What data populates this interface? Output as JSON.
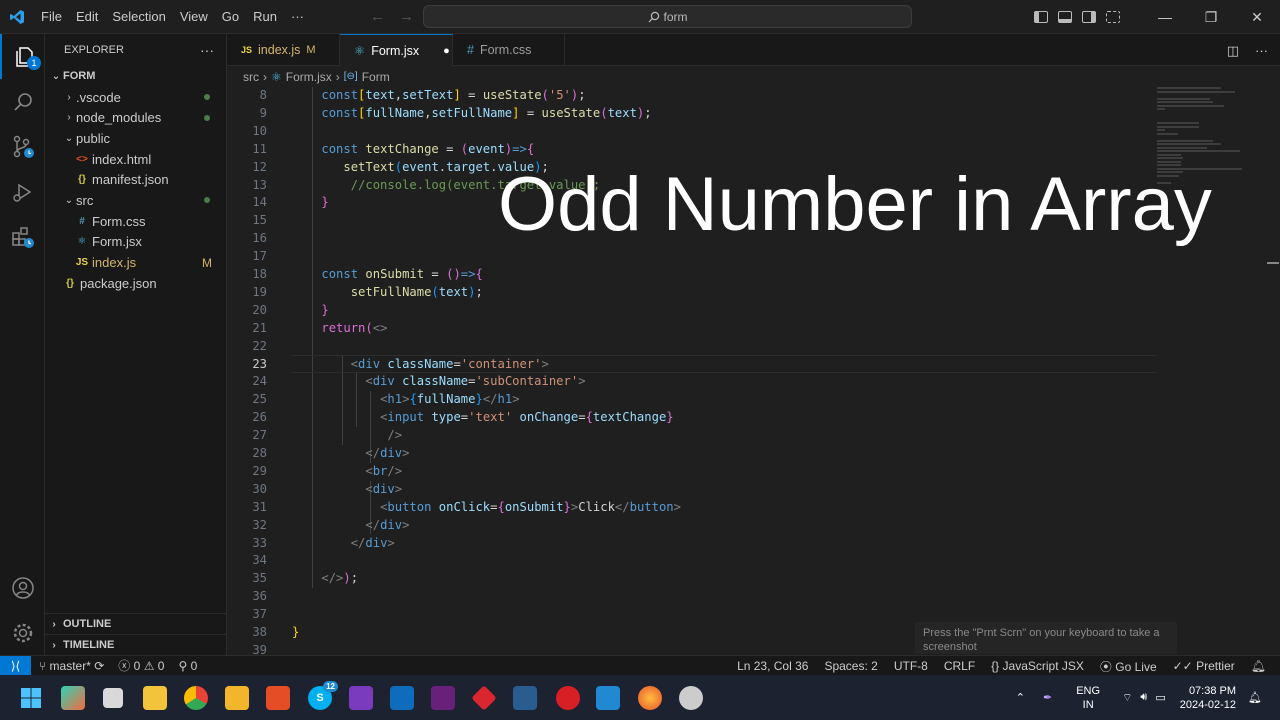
{
  "titlebar": {
    "menu": [
      "File",
      "Edit",
      "Selection",
      "View",
      "Go",
      "Run",
      "···"
    ],
    "search_text": "form",
    "minimize": "—",
    "maximize": "❐",
    "close": "✕"
  },
  "activity": {
    "explorer_badge": "1"
  },
  "sidebar": {
    "header": "EXPLORER",
    "more": "···",
    "root": "FORM",
    "items": [
      {
        "label": ".vscode",
        "type": "folder",
        "chev": "›",
        "git": "dot"
      },
      {
        "label": "node_modules",
        "type": "folder",
        "chev": "›",
        "git": "dot"
      },
      {
        "label": "public",
        "type": "folder",
        "chev": "⌄",
        "git": ""
      },
      {
        "label": "index.html",
        "type": "html",
        "icon": "<>",
        "git": ""
      },
      {
        "label": "manifest.json",
        "type": "json",
        "icon": "{}",
        "git": ""
      },
      {
        "label": "src",
        "type": "folder",
        "chev": "⌄",
        "git": "dot"
      },
      {
        "label": "Form.css",
        "type": "css",
        "icon": "#",
        "git": ""
      },
      {
        "label": "Form.jsx",
        "type": "jsx",
        "icon": "⚛",
        "git": ""
      },
      {
        "label": "index.js",
        "type": "js",
        "icon": "JS",
        "git": "M"
      },
      {
        "label": "package.json",
        "type": "json",
        "icon": "{}",
        "git": ""
      }
    ],
    "outline": "OUTLINE",
    "timeline": "TIMELINE"
  },
  "tabs": [
    {
      "label": "index.js",
      "icon": "JS",
      "suffix": "M",
      "active": false
    },
    {
      "label": "Form.jsx",
      "icon": "⚛",
      "suffix": "●",
      "active": true
    },
    {
      "label": "Form.css",
      "icon": "#",
      "suffix": "",
      "active": false
    }
  ],
  "breadcrumb": [
    "src",
    "›",
    "Form.jsx",
    "›",
    "Form"
  ],
  "editor": {
    "current_line": 23,
    "overlay_title": "Odd Number in Array",
    "toast": "Press the \"Prnt Scrn\" on your keyboard to take a screenshot",
    "lines": [
      {
        "n": 8,
        "tokens": [
          [
            "    ",
            "txt"
          ],
          [
            "const",
            "kw"
          ],
          [
            "[",
            "br1"
          ],
          [
            "text",
            "var"
          ],
          [
            ",",
            "pun"
          ],
          [
            "setText",
            "var"
          ],
          [
            "]",
            "br1"
          ],
          [
            " = ",
            "pun"
          ],
          [
            "useState",
            "fn"
          ],
          [
            "(",
            "br2"
          ],
          [
            "'5'",
            "str"
          ],
          [
            ")",
            "br2"
          ],
          [
            ";",
            "pun"
          ]
        ]
      },
      {
        "n": 9,
        "tokens": [
          [
            "    ",
            "txt"
          ],
          [
            "const",
            "kw"
          ],
          [
            "[",
            "br1"
          ],
          [
            "fullName",
            "var"
          ],
          [
            ",",
            "pun"
          ],
          [
            "setFullName",
            "var"
          ],
          [
            "]",
            "br1"
          ],
          [
            " = ",
            "pun"
          ],
          [
            "useState",
            "fn"
          ],
          [
            "(",
            "br2"
          ],
          [
            "text",
            "var"
          ],
          [
            ")",
            "br2"
          ],
          [
            ";",
            "pun"
          ]
        ]
      },
      {
        "n": 10,
        "tokens": []
      },
      {
        "n": 11,
        "tokens": [
          [
            "    ",
            "txt"
          ],
          [
            "const",
            "kw"
          ],
          [
            " ",
            "txt"
          ],
          [
            "textChange",
            "fn"
          ],
          [
            " = ",
            "pun"
          ],
          [
            "(",
            "br2"
          ],
          [
            "event",
            "var"
          ],
          [
            ")",
            "br2"
          ],
          [
            "=>",
            "kw"
          ],
          [
            "{",
            "br2"
          ]
        ]
      },
      {
        "n": 12,
        "tokens": [
          [
            "       ",
            "txt"
          ],
          [
            "setText",
            "fn"
          ],
          [
            "(",
            "br3"
          ],
          [
            "event",
            "var"
          ],
          [
            ".",
            "pun"
          ],
          [
            "target",
            "var"
          ],
          [
            ".",
            "pun"
          ],
          [
            "value",
            "var"
          ],
          [
            ")",
            "br3"
          ],
          [
            ";",
            "pun"
          ]
        ]
      },
      {
        "n": 13,
        "tokens": [
          [
            "        ",
            "txt"
          ],
          [
            "//console.log(event.target.value);",
            "cmt"
          ]
        ]
      },
      {
        "n": 14,
        "tokens": [
          [
            "    ",
            "txt"
          ],
          [
            "}",
            "br2"
          ]
        ]
      },
      {
        "n": 15,
        "tokens": []
      },
      {
        "n": 16,
        "tokens": []
      },
      {
        "n": 17,
        "tokens": []
      },
      {
        "n": 18,
        "tokens": [
          [
            "    ",
            "txt"
          ],
          [
            "const",
            "kw"
          ],
          [
            " ",
            "txt"
          ],
          [
            "onSubmit",
            "fn"
          ],
          [
            " = ",
            "pun"
          ],
          [
            "()",
            "br2"
          ],
          [
            "=>",
            "kw"
          ],
          [
            "{",
            "br2"
          ]
        ]
      },
      {
        "n": 19,
        "tokens": [
          [
            "        ",
            "txt"
          ],
          [
            "setFullName",
            "fn"
          ],
          [
            "(",
            "br3"
          ],
          [
            "text",
            "var"
          ],
          [
            ")",
            "br3"
          ],
          [
            ";",
            "pun"
          ]
        ]
      },
      {
        "n": 20,
        "tokens": [
          [
            "    ",
            "txt"
          ],
          [
            "}",
            "br2"
          ]
        ]
      },
      {
        "n": 21,
        "tokens": [
          [
            "    ",
            "txt"
          ],
          [
            "return",
            "br2"
          ],
          [
            "(",
            "br2"
          ],
          [
            "<>",
            "tagb"
          ]
        ]
      },
      {
        "n": 22,
        "tokens": []
      },
      {
        "n": 23,
        "tokens": [
          [
            "        ",
            "txt"
          ],
          [
            "<",
            "tagb"
          ],
          [
            "div",
            "tag"
          ],
          [
            " ",
            "txt"
          ],
          [
            "className",
            "attr"
          ],
          [
            "=",
            "pun"
          ],
          [
            "'container'",
            "str"
          ],
          [
            ">",
            "tagb"
          ]
        ]
      },
      {
        "n": 24,
        "tokens": [
          [
            "          ",
            "txt"
          ],
          [
            "<",
            "tagb"
          ],
          [
            "div",
            "tag"
          ],
          [
            " ",
            "txt"
          ],
          [
            "className",
            "attr"
          ],
          [
            "=",
            "pun"
          ],
          [
            "'subContainer'",
            "str"
          ],
          [
            ">",
            "tagb"
          ]
        ]
      },
      {
        "n": 25,
        "tokens": [
          [
            "            ",
            "txt"
          ],
          [
            "<",
            "tagb"
          ],
          [
            "h1",
            "tag"
          ],
          [
            ">",
            "tagb"
          ],
          [
            "{",
            "br3"
          ],
          [
            "fullName",
            "var"
          ],
          [
            "}",
            "br3"
          ],
          [
            "</",
            "tagb"
          ],
          [
            "h1",
            "tag"
          ],
          [
            ">",
            "tagb"
          ]
        ]
      },
      {
        "n": 26,
        "tokens": [
          [
            "            ",
            "txt"
          ],
          [
            "<",
            "tagb"
          ],
          [
            "input",
            "tag"
          ],
          [
            " ",
            "txt"
          ],
          [
            "type",
            "attr"
          ],
          [
            "=",
            "pun"
          ],
          [
            "'text'",
            "str"
          ],
          [
            " ",
            "txt"
          ],
          [
            "onChange",
            "attr"
          ],
          [
            "=",
            "pun"
          ],
          [
            "{",
            "br2"
          ],
          [
            "textChange",
            "var"
          ],
          [
            "}",
            "br2"
          ]
        ]
      },
      {
        "n": 27,
        "tokens": [
          [
            "             ",
            "txt"
          ],
          [
            "/>",
            "tagb"
          ]
        ]
      },
      {
        "n": 28,
        "tokens": [
          [
            "          ",
            "txt"
          ],
          [
            "</",
            "tagb"
          ],
          [
            "div",
            "tag"
          ],
          [
            ">",
            "tagb"
          ]
        ]
      },
      {
        "n": 29,
        "tokens": [
          [
            "          ",
            "txt"
          ],
          [
            "<",
            "tagb"
          ],
          [
            "br",
            "tag"
          ],
          [
            "/>",
            "tagb"
          ]
        ]
      },
      {
        "n": 30,
        "tokens": [
          [
            "          ",
            "txt"
          ],
          [
            "<",
            "tagb"
          ],
          [
            "div",
            "tag"
          ],
          [
            ">",
            "tagb"
          ]
        ]
      },
      {
        "n": 31,
        "tokens": [
          [
            "            ",
            "txt"
          ],
          [
            "<",
            "tagb"
          ],
          [
            "button",
            "tag"
          ],
          [
            " ",
            "txt"
          ],
          [
            "onClick",
            "attr"
          ],
          [
            "=",
            "pun"
          ],
          [
            "{",
            "br2"
          ],
          [
            "onSubmit",
            "var"
          ],
          [
            "}",
            "br2"
          ],
          [
            ">",
            "tagb"
          ],
          [
            "Click",
            "txt"
          ],
          [
            "</",
            "tagb"
          ],
          [
            "button",
            "tag"
          ],
          [
            ">",
            "tagb"
          ]
        ]
      },
      {
        "n": 32,
        "tokens": [
          [
            "          ",
            "txt"
          ],
          [
            "</",
            "tagb"
          ],
          [
            "div",
            "tag"
          ],
          [
            ">",
            "tagb"
          ]
        ]
      },
      {
        "n": 33,
        "tokens": [
          [
            "        ",
            "txt"
          ],
          [
            "</",
            "tagb"
          ],
          [
            "div",
            "tag"
          ],
          [
            ">",
            "tagb"
          ]
        ]
      },
      {
        "n": 34,
        "tokens": []
      },
      {
        "n": 35,
        "tokens": [
          [
            "    ",
            "txt"
          ],
          [
            "</>",
            "tagb"
          ],
          [
            ")",
            "br2"
          ],
          [
            ";",
            "pun"
          ]
        ]
      },
      {
        "n": 36,
        "tokens": []
      },
      {
        "n": 37,
        "tokens": []
      },
      {
        "n": 38,
        "tokens": [
          [
            "",
            "txt"
          ],
          [
            "}",
            "br1"
          ]
        ]
      },
      {
        "n": 39,
        "tokens": []
      }
    ]
  },
  "status": {
    "branch": "master*",
    "errors": "0",
    "warnings": "0",
    "ports": "0",
    "position": "Ln 23, Col 36",
    "spaces": "Spaces: 2",
    "encoding": "UTF-8",
    "eol": "CRLF",
    "language": "JavaScript JSX",
    "golive": "Go Live",
    "prettier": "Prettier"
  },
  "taskbar": {
    "lang1": "ENG",
    "lang2": "IN",
    "time": "07:38 PM",
    "date": "2024-02-12",
    "skype_badge": "12"
  },
  "colors": {
    "accent": "#0078d4",
    "editor_bg": "#1f1f1f",
    "sidebar_bg": "#181818"
  }
}
